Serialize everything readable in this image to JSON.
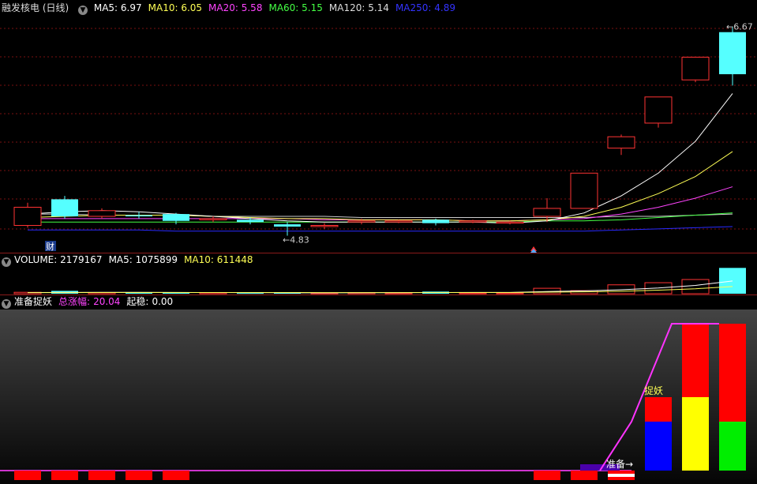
{
  "header": {
    "stock_name": "融发核电 (日线)",
    "ma": [
      {
        "label": "MA5: 6.97",
        "color": "#ffffff"
      },
      {
        "label": "MA10: 6.05",
        "color": "#ffff55"
      },
      {
        "label": "MA20: 5.58",
        "color": "#ff44ff"
      },
      {
        "label": "MA60: 5.15",
        "color": "#44ff44"
      },
      {
        "label": "MA120: 5.14",
        "color": "#dddddd"
      },
      {
        "label": "MA250: 4.89",
        "color": "#3333ff"
      }
    ]
  },
  "price_chart": {
    "high_label": "6.67",
    "low_label": "4.83",
    "finance_tag": "财",
    "candles": [
      {
        "o": 4.92,
        "c": 5.08,
        "h": 5.12,
        "l": 4.9,
        "up": true
      },
      {
        "o": 5.15,
        "c": 5.0,
        "h": 5.18,
        "l": 4.98,
        "up": false
      },
      {
        "o": 5.0,
        "c": 5.05,
        "h": 5.07,
        "l": 4.98,
        "up": true
      },
      {
        "o": 5.01,
        "c": 5.0,
        "h": 5.04,
        "l": 4.98,
        "up": false
      },
      {
        "o": 5.02,
        "c": 4.96,
        "h": 5.03,
        "l": 4.93,
        "up": false
      },
      {
        "o": 4.97,
        "c": 4.98,
        "h": 5.0,
        "l": 4.95,
        "up": true
      },
      {
        "o": 4.97,
        "c": 4.95,
        "h": 4.99,
        "l": 4.93,
        "up": false
      },
      {
        "o": 4.93,
        "c": 4.91,
        "h": 4.95,
        "l": 4.83,
        "up": false
      },
      {
        "o": 4.91,
        "c": 4.92,
        "h": 4.94,
        "l": 4.89,
        "up": true
      },
      {
        "o": 4.95,
        "c": 4.96,
        "h": 4.98,
        "l": 4.93,
        "up": true
      },
      {
        "o": 4.96,
        "c": 4.95,
        "h": 4.97,
        "l": 4.94,
        "up": true
      },
      {
        "o": 4.97,
        "c": 4.94,
        "h": 4.98,
        "l": 4.92,
        "up": false
      },
      {
        "o": 4.96,
        "c": 4.95,
        "h": 4.97,
        "l": 4.94,
        "up": true
      },
      {
        "o": 4.94,
        "c": 4.95,
        "h": 4.96,
        "l": 4.93,
        "up": true
      },
      {
        "o": 5.0,
        "c": 5.07,
        "h": 5.16,
        "l": 4.95,
        "up": true
      },
      {
        "o": 5.07,
        "c": 5.38,
        "h": 5.38,
        "l": 5.07,
        "up": true
      },
      {
        "o": 5.6,
        "c": 5.7,
        "h": 5.72,
        "l": 5.54,
        "up": true
      },
      {
        "o": 5.82,
        "c": 6.05,
        "h": 6.05,
        "l": 5.78,
        "up": true
      },
      {
        "o": 6.2,
        "c": 6.4,
        "h": 6.4,
        "l": 6.18,
        "up": true
      },
      {
        "o": 6.62,
        "c": 6.25,
        "h": 6.67,
        "l": 6.15,
        "up": false
      }
    ],
    "ma5": [
      5.02,
      5.04,
      5.05,
      5.04,
      5.02,
      5.0,
      4.98,
      4.96,
      4.95,
      4.95,
      4.95,
      4.95,
      4.95,
      4.94,
      4.96,
      5.03,
      5.18,
      5.38,
      5.66,
      6.08
    ],
    "ma10": [
      4.99,
      5.0,
      5.01,
      5.01,
      5.01,
      5.0,
      4.99,
      4.98,
      4.98,
      4.97,
      4.97,
      4.97,
      4.96,
      4.96,
      4.97,
      5.0,
      5.08,
      5.2,
      5.35,
      5.57
    ],
    "ma20": [
      4.98,
      4.98,
      4.98,
      4.98,
      4.98,
      4.98,
      4.98,
      4.98,
      4.97,
      4.97,
      4.97,
      4.97,
      4.96,
      4.96,
      4.97,
      4.98,
      5.02,
      5.08,
      5.16,
      5.26
    ],
    "ma60": [
      4.95,
      4.95,
      4.95,
      4.95,
      4.95,
      4.95,
      4.95,
      4.95,
      4.95,
      4.95,
      4.95,
      4.95,
      4.95,
      4.95,
      4.96,
      4.96,
      4.97,
      4.99,
      5.01,
      5.03
    ],
    "ma120": [
      5.02,
      5.02,
      5.01,
      5.01,
      5.01,
      5.0,
      5.0,
      5.0,
      5.0,
      4.99,
      4.99,
      4.99,
      4.99,
      4.99,
      4.99,
      4.99,
      5.0,
      5.0,
      5.01,
      5.02
    ],
    "ma250": [
      4.88,
      4.88,
      4.88,
      4.88,
      4.87,
      4.87,
      4.87,
      4.87,
      4.87,
      4.87,
      4.87,
      4.87,
      4.87,
      4.87,
      4.87,
      4.87,
      4.88,
      4.89,
      4.9,
      4.91
    ]
  },
  "volume": {
    "label": "VOLUME: 2179167",
    "ma5": "MA5: 1075899",
    "ma10": "MA10: 611448",
    "bars": [
      120000,
      240000,
      90000,
      80000,
      70000,
      80000,
      60000,
      70000,
      60000,
      90000,
      60000,
      180000,
      60000,
      60000,
      460000,
      260000,
      750000,
      930000,
      1200000,
      2179167
    ],
    "up": [
      true,
      false,
      true,
      false,
      false,
      true,
      false,
      false,
      true,
      true,
      true,
      false,
      true,
      true,
      true,
      true,
      true,
      true,
      true,
      false
    ],
    "ma5_line": [
      100000,
      110000,
      115000,
      115000,
      110000,
      100000,
      90000,
      80000,
      75000,
      80000,
      90000,
      100000,
      105000,
      110000,
      180000,
      240000,
      330000,
      480000,
      700000,
      1075899
    ],
    "ma10_line": [
      90000,
      95000,
      100000,
      100000,
      100000,
      100000,
      100000,
      100000,
      95000,
      95000,
      95000,
      100000,
      100000,
      100000,
      130000,
      160000,
      210000,
      300000,
      420000,
      611448
    ]
  },
  "indicator": {
    "name": "准备捉妖",
    "total_label": "总涨幅:",
    "total_value": "20.04",
    "start_label": "起稳:",
    "start_value": "0.00",
    "tag_zhunbei": "准备→",
    "tag_zhuoyao": "捉妖"
  }
}
